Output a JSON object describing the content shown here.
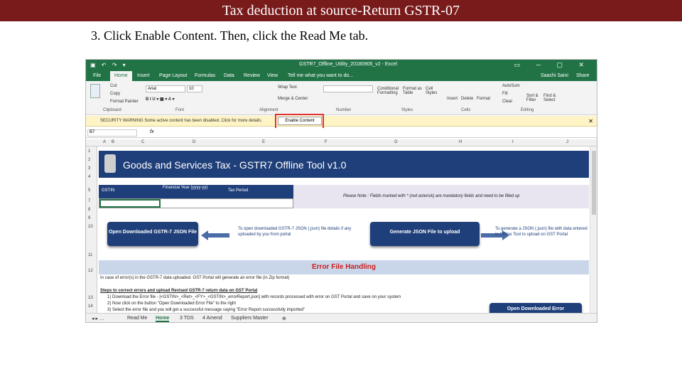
{
  "slide": {
    "title": "Tax deduction at source-Return GSTR-07",
    "instruction": "3. Click Enable Content. Then, click the Read Me tab."
  },
  "excel": {
    "filename": "GSTR7_Offline_Utility_20180905_v2 - Excel",
    "user": "Saachi Saini",
    "share": "Share",
    "ribbon_tabs": [
      "File",
      "Home",
      "Insert",
      "Page Layout",
      "Formulas",
      "Data",
      "Review",
      "View"
    ],
    "tell_me": "Tell me what you want to do...",
    "font_name": "Arial",
    "font_size": "10",
    "wrap_text": "Wrap Text",
    "merge_center": "Merge & Center",
    "autosum": "AutoSum",
    "fill": "Fill",
    "clear": "Clear",
    "cut": "Cut",
    "copy": "Copy",
    "format_painter": "Format Painter",
    "groups": [
      "Clipboard",
      "Font",
      "Alignment",
      "Number",
      "Styles",
      "Cells",
      "Editing"
    ],
    "cells_buttons": [
      "Insert",
      "Delete",
      "Format"
    ],
    "styles_buttons": [
      "Conditional Formatting",
      "Format as Table",
      "Cell Styles"
    ],
    "editing_buttons": [
      "Sort & Filter",
      "Find & Select"
    ],
    "security_warning": "SECURITY WARNING  Some active content has been disabled. Click for more details.",
    "enable_content": "Enable Content",
    "name_box": "B7",
    "fx": "fx",
    "columns": [
      "A",
      "B",
      "C",
      "D",
      "E",
      "F",
      "G",
      "H",
      "I",
      "J"
    ],
    "rows": [
      "1",
      "2",
      "3",
      "4",
      "5",
      "7",
      "8",
      "9",
      "10",
      "11",
      "12",
      "13",
      "14"
    ],
    "banner_title": "Goods and Services Tax - GSTR7 Offline Tool  v1.0",
    "gstin": "GSTIN",
    "financial_year": "Financial Year (yyyy-yy)",
    "tax_period": "Tax Period",
    "note": "Please Note : Fields marked with * (red asterisk) are mandatory fields and need to be filled up",
    "open_button": "Open Downloaded GSTR-7 JSON File",
    "open_side": "To open downloaded GSTR-7 JSON (.json) file details if any uploaded by you from portal",
    "generate_button": "Generate JSON File to upload",
    "generate_side": "To generate a JSON (.json) file with data entered in Offline Tool to upload on GST Portal",
    "error_title": "Error File Handling",
    "error_line1": "In case of error(s) in the GSTR-7 data uploaded. GST Portal will generate an error file (in Zip format)",
    "error_steps_title": "Steps to correct errors and upload Revised GSTR-7 return data on GST Portal",
    "error_step1": "1) Download the Error file - [<GSTIN>_<Ret>_<FY>_<GSTIN>_errorReport.json] with records processed with error on GST Portal and save on your system",
    "error_step2": "2) Now click on the button \"Open Downloaded Error File\" to the right",
    "error_step3": "3) Select the error file and you will get a successful message saying \"Error Report successfully imported\"",
    "open_error_button": "Open Downloaded Error",
    "sheet_tabs": [
      "Read Me",
      "Home",
      "3 TDS",
      "4 Amend",
      "Suppliers Master"
    ]
  }
}
